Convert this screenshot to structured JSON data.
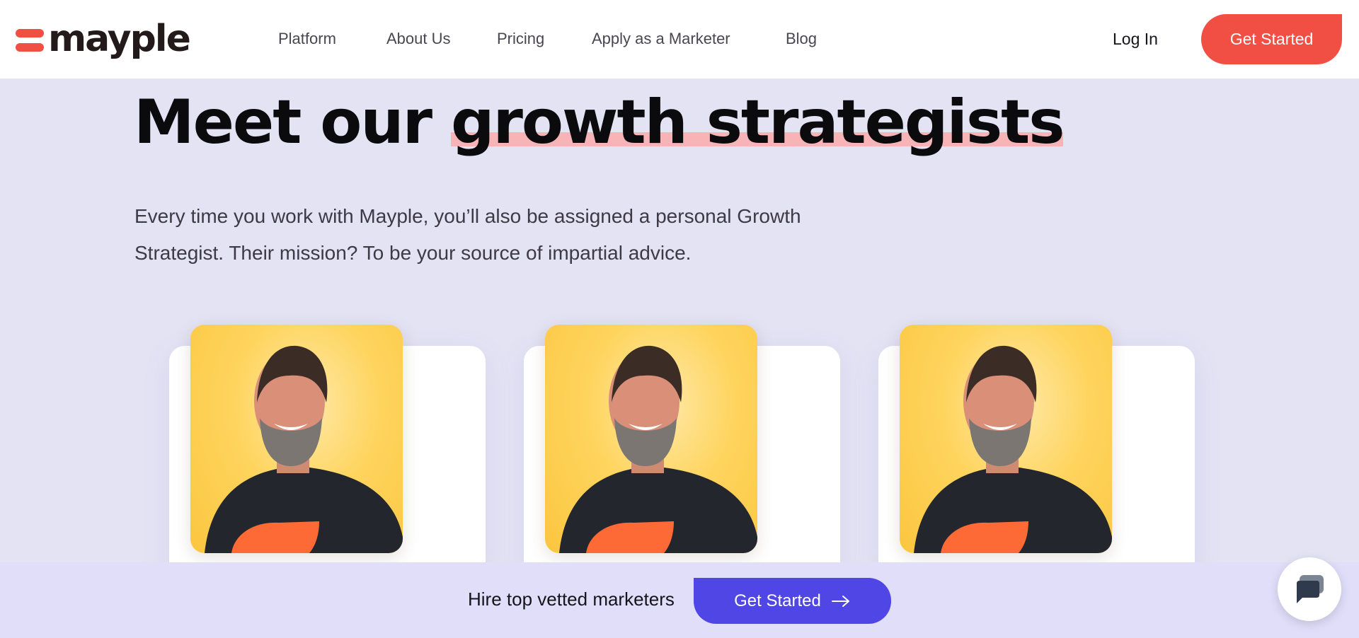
{
  "brand": {
    "name": "mayple",
    "accent": "#f14f43"
  },
  "nav": {
    "items": [
      {
        "label": "Platform"
      },
      {
        "label": "About Us"
      },
      {
        "label": "Pricing"
      },
      {
        "label": "Apply as a Marketer"
      },
      {
        "label": "Blog"
      }
    ],
    "login_label": "Log In",
    "cta_label": "Get Started"
  },
  "hero": {
    "title_prefix": "Meet our ",
    "title_highlight": "growth strategists",
    "subtitle": "Every time you work with Mayple, you’ll also be assigned a personal Growth Strategist. Their mission? To be your source of impartial advice."
  },
  "cards": [
    {
      "photo": "strategist-portrait"
    },
    {
      "photo": "strategist-portrait"
    },
    {
      "photo": "strategist-portrait"
    }
  ],
  "sticky": {
    "text": "Hire top vetted marketers",
    "cta_label": "Get Started",
    "cta_icon": "arrow-right-icon",
    "cta_color": "#5046e5"
  },
  "chat": {
    "icon": "chat-bubble-icon"
  }
}
